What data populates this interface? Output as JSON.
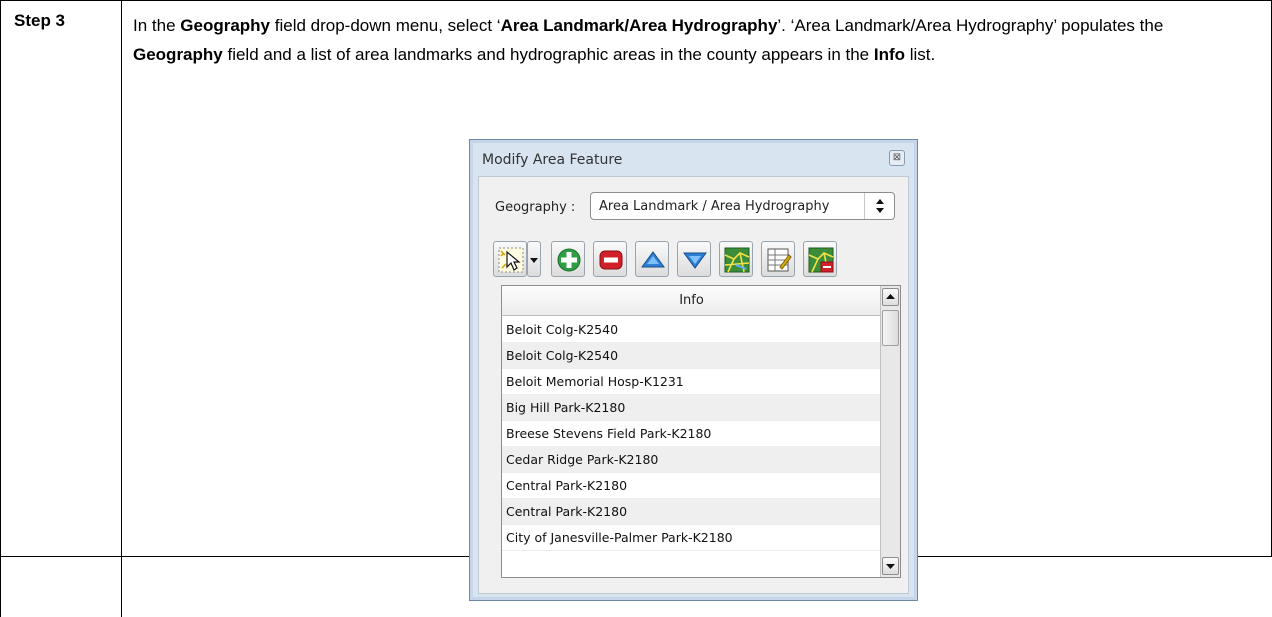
{
  "step": "Step 3",
  "instruction": {
    "t1": "In the ",
    "b1": "Geography",
    "t2": " field drop-down menu, select ‘",
    "b2": "Area Landmark/Area Hydrography",
    "t3": "’. ‘Area Landmark/Area Hydrography’ populates the ",
    "b3": "Geography",
    "t4": " field and a list of area landmarks and hydrographic areas in the county appears in the ",
    "b4": "Info",
    "t5": " list."
  },
  "dialog": {
    "title": "Modify Area Feature",
    "close_glyph": "⊠",
    "geography_label": "Geography :",
    "geography_value": "Area Landmark / Area Hydrography",
    "list_header": "Info",
    "rows": [
      "Beloit Colg-K2540",
      "Beloit Colg-K2540",
      "Beloit Memorial Hosp-K1231",
      "Big Hill Park-K2180",
      "Breese Stevens Field Park-K2180",
      "Cedar Ridge Park-K2180",
      "Central Park-K2180",
      "Central Park-K2180",
      "City of Janesville-Palmer Park-K2180"
    ],
    "toolbar_icons": [
      "select-arrow-icon",
      "dropdown-icon",
      "add-icon",
      "remove-icon",
      "move-up-icon",
      "move-down-icon",
      "map-icon",
      "table-edit-icon",
      "map-remove-icon"
    ]
  },
  "colors": {
    "dialog_frame": "#d8e4f0",
    "add_green": "#2ea043",
    "remove_red": "#d0202a",
    "arrow_blue": "#2e7fd6"
  }
}
